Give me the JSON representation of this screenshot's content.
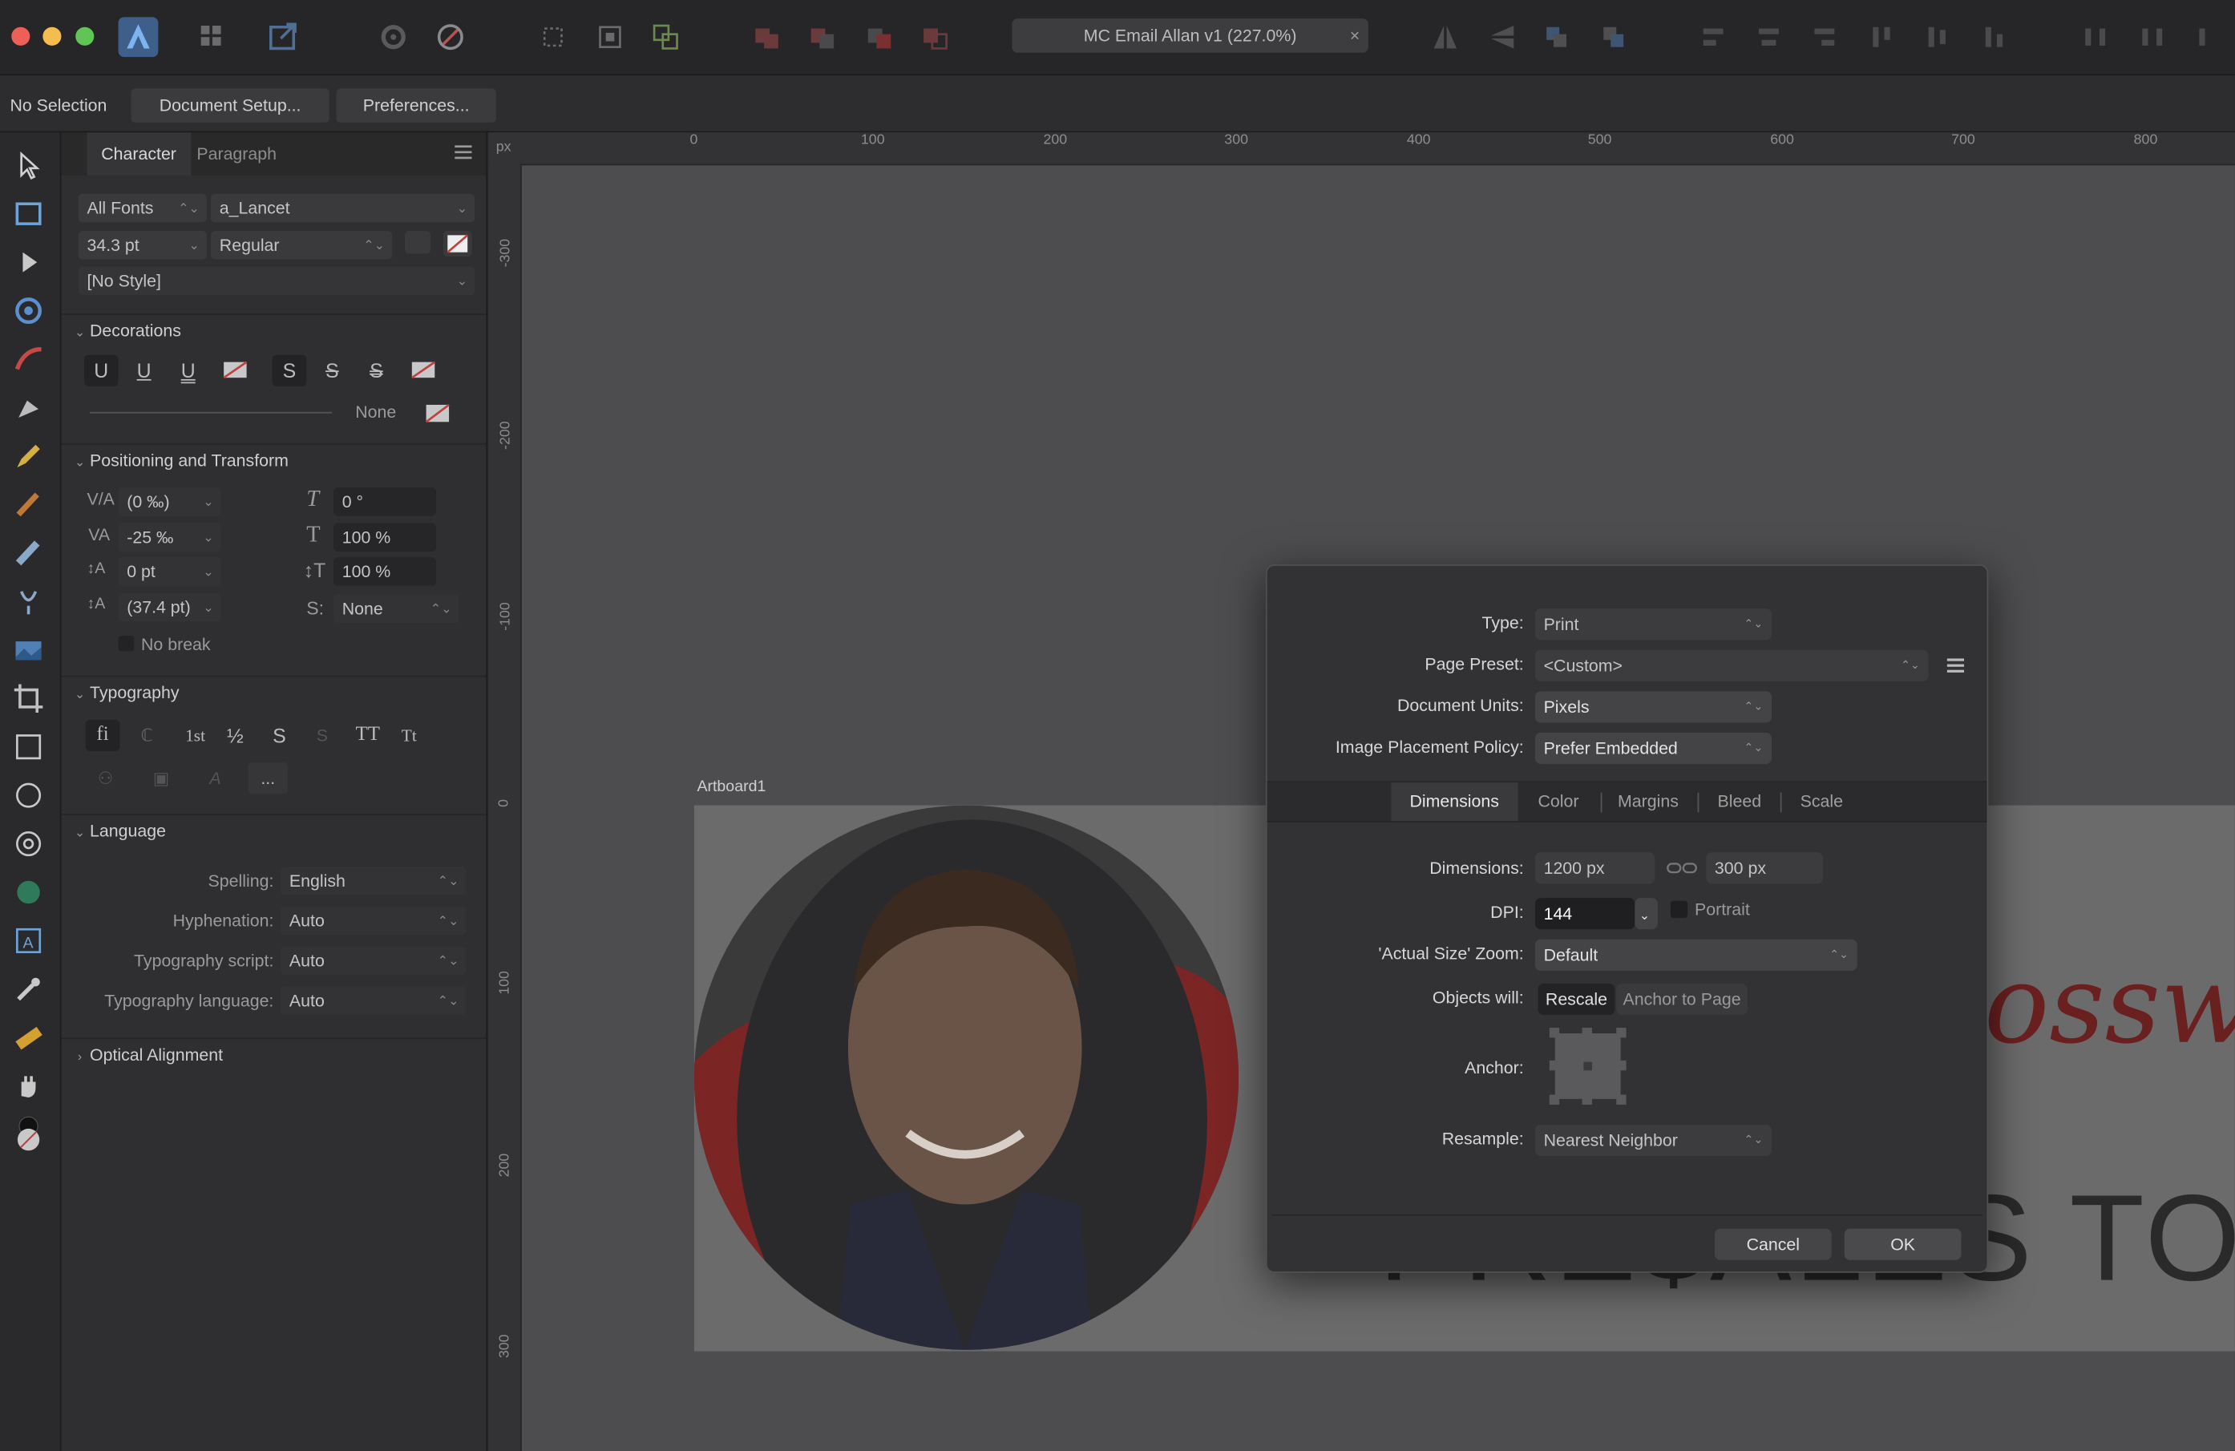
{
  "toolbar": {
    "document_title": "MC Email Allan v1 (227.0%)",
    "close_glyph": "×"
  },
  "context": {
    "selection": "No Selection",
    "document_setup": "Document Setup...",
    "preferences": "Preferences..."
  },
  "panel": {
    "tab_character": "Character",
    "tab_paragraph": "Paragraph",
    "font_collection": "All Fonts",
    "font_family": "a_Lancet",
    "font_size": "34.3 pt",
    "font_style": "Regular",
    "style": "[No Style]",
    "decorations": {
      "title": "Decorations",
      "none_label": "None"
    },
    "positioning": {
      "title": "Positioning and Transform",
      "kerning": "(0 ‰)",
      "tracking": "-25 ‰",
      "baseline": "0 pt",
      "leading": "(37.4 pt)",
      "shear": "0 °",
      "vscale": "100 %",
      "hscale": "100 %",
      "superscript": "None",
      "no_break": "No break"
    },
    "typography": {
      "title": "Typography",
      "buttons": [
        "fi",
        "ℂ",
        "1st",
        "½",
        "S",
        "S",
        "TT",
        "Tt"
      ],
      "more": "..."
    },
    "language": {
      "title": "Language",
      "spelling_label": "Spelling:",
      "spelling": "English",
      "hyphenation_label": "Hyphenation:",
      "hyphenation": "Auto",
      "script_label": "Typography script:",
      "script": "Auto",
      "language_label": "Typography language:",
      "language": "Auto"
    },
    "optical": {
      "title": "Optical Alignment"
    }
  },
  "canvas": {
    "ruler_unit": "px",
    "ruler_top": [
      "0",
      "100",
      "200",
      "300",
      "400",
      "500",
      "600",
      "700",
      "800"
    ],
    "ruler_left": [
      "-300",
      "-200",
      "-100",
      "0",
      "100",
      "200",
      "300"
    ],
    "artboard_label": "Artboard1",
    "headline_fragment": "PRE$ALES TO PRO",
    "script_fragment": "ossw"
  },
  "dialog": {
    "type_label": "Type:",
    "type_value": "Print",
    "preset_label": "Page Preset:",
    "preset_value": "<Custom>",
    "units_label": "Document Units:",
    "units_value": "Pixels",
    "placement_label": "Image Placement Policy:",
    "placement_value": "Prefer Embedded",
    "tabs": [
      "Dimensions",
      "Color",
      "Margins",
      "Bleed",
      "Scale"
    ],
    "dimensions_label": "Dimensions:",
    "width": "1200 px",
    "height": "300 px",
    "dpi_label": "DPI:",
    "dpi_value": "144",
    "portrait_label": "Portrait",
    "zoom_label": "'Actual Size' Zoom:",
    "zoom_value": "Default",
    "objects_label": "Objects will:",
    "rescale": "Rescale",
    "anchor_to_page": "Anchor to Page",
    "anchor_label": "Anchor:",
    "resample_label": "Resample:",
    "resample_value": "Nearest Neighbor",
    "cancel": "Cancel",
    "ok": "OK"
  }
}
